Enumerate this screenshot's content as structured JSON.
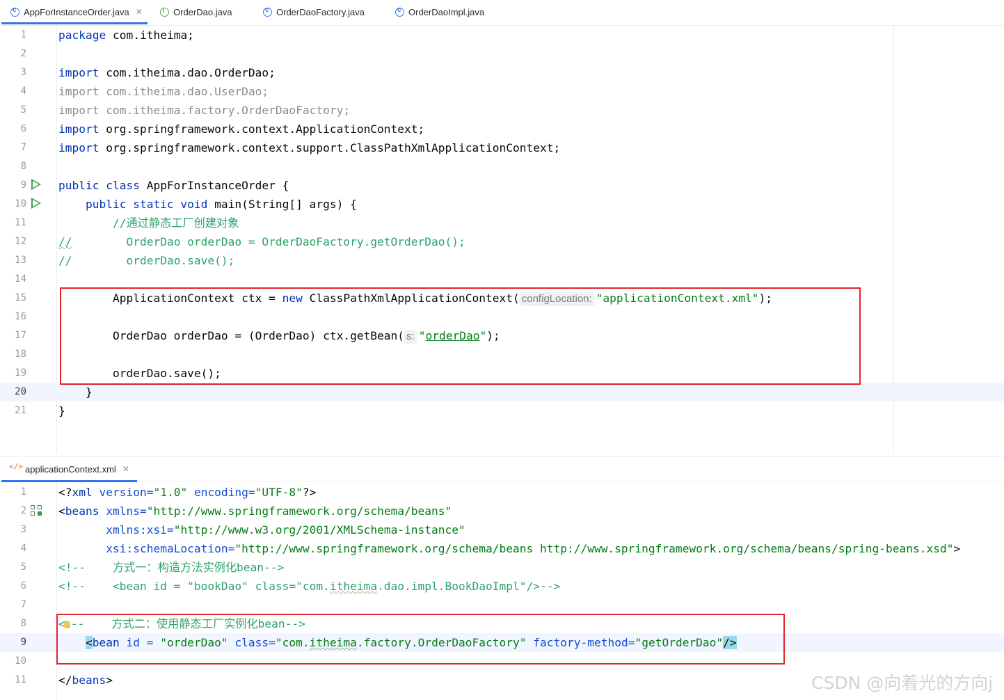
{
  "top_tabs": [
    {
      "label": "AppForInstanceOrder.java",
      "icon": "class-icon",
      "active": true,
      "closable": true
    },
    {
      "label": "OrderDao.java",
      "icon": "interface-icon"
    },
    {
      "label": "OrderDaoFactory.java",
      "icon": "class-icon"
    },
    {
      "label": "OrderDaoImpl.java",
      "icon": "class-icon"
    }
  ],
  "java_code": {
    "line_numbers": [
      "1",
      "2",
      "3",
      "4",
      "5",
      "6",
      "7",
      "8",
      "9",
      "10",
      "11",
      "12",
      "13",
      "14",
      "15",
      "16",
      "17",
      "18",
      "19",
      "20",
      "21"
    ],
    "l1": {
      "kw": "package",
      "rest": " com.itheima;"
    },
    "l3": {
      "kw": "import",
      "rest": " com.itheima.dao.OrderDao;"
    },
    "l4": {
      "kw": "import",
      "rest": " com.itheima.dao.UserDao;"
    },
    "l5": {
      "kw": "import",
      "rest": " com.itheima.factory.OrderDaoFactory;"
    },
    "l6": {
      "kw": "import",
      "rest": " org.springframework.context.ApplicationContext;"
    },
    "l7": {
      "kw": "import",
      "rest": " org.springframework.context.support.ClassPathXmlApplicationContext;"
    },
    "l9": {
      "kw": "public class",
      "rest": " AppForInstanceOrder {"
    },
    "l10": {
      "indent": "    ",
      "kw": "public static void",
      "rest": " main(String[] args) {"
    },
    "l11": {
      "indent": "        ",
      "comment": "//通过静态工厂创建对象"
    },
    "l12": {
      "prefix": "//",
      "indent": "        ",
      "comment": "OrderDao orderDao = OrderDaoFactory.getOrderDao();"
    },
    "l13": {
      "prefix": "//",
      "indent": "        ",
      "comment": "orderDao.save();"
    },
    "l15": {
      "indent": "        ",
      "a": "ApplicationContext ctx = ",
      "kw": "new",
      "b": " ClassPathXmlApplicationContext(",
      "hint": "configLocation:",
      "str": "\"applicationContext.xml\"",
      "end": ");"
    },
    "l17": {
      "indent": "        ",
      "a": "OrderDao orderDao = (OrderDao) ctx.getBean(",
      "hint": "s:",
      "q1": "\"",
      "str": "orderDao",
      "q2": "\"",
      "end": ");"
    },
    "l19": {
      "indent": "        ",
      "a": "orderDao.save();"
    },
    "l20": {
      "indent": "    ",
      "a": "}"
    },
    "l21": {
      "a": "}"
    }
  },
  "xml_tab": {
    "label": "applicationContext.xml",
    "icon": "xml-file-icon",
    "closable": true
  },
  "xml_code": {
    "line_numbers": [
      "1",
      "2",
      "3",
      "4",
      "5",
      "6",
      "7",
      "8",
      "9",
      "10",
      "11"
    ],
    "l1": {
      "p1": "<?",
      "tag": "xml",
      "a1": " version",
      "eq1": "=",
      "v1": "\"1.0\"",
      "a2": " encoding",
      "eq2": "=",
      "v2": "\"UTF-8\"",
      "p2": "?>"
    },
    "l2": {
      "p1": "<",
      "tag": "beans",
      "a1": " xmlns",
      "eq1": "=",
      "v1": "\"http://www.springframework.org/schema/beans\""
    },
    "l3": {
      "indent": "       ",
      "a1": "xmlns:xsi",
      "eq1": "=",
      "v1": "\"http://www.w3.org/2001/XMLSchema-instance\""
    },
    "l4": {
      "indent": "       ",
      "a1": "xsi:schemaLocation",
      "eq1": "=",
      "v1": "\"http://www.springframework.org/schema/beans http://www.springframework.org/schema/beans/spring-beans.xsd\"",
      "p2": ">"
    },
    "l5": {
      "comment": "<!--    方式一：构造方法实例化bean-->"
    },
    "l6": {
      "comment_a": "<!--    <bean id = \"bookDao\" class=\"com.",
      "comment_sq": "itheima",
      "comment_b": ".dao.impl.BookDaoImpl\"/>-->"
    },
    "l8": {
      "comment_a": "<",
      "comment_b": "--    方式二：使用静态工厂实例化bean-->"
    },
    "l9": {
      "indent": "    ",
      "p1": "<",
      "tag": "bean",
      "a1": " id = ",
      "v1": "\"orderDao\"",
      "a2": " class",
      "eq2": "=",
      "v2a": "\"com.",
      "v2sq": "itheima",
      "v2b": ".factory.OrderDaoFactory\"",
      "a3": " factory-method",
      "eq3": "=",
      "v3": "\"getOrderDao\"",
      "p2": "/>"
    },
    "l11": {
      "p1": "</",
      "tag": "beans",
      "p2": ">"
    }
  },
  "watermark": "CSDN @向着光的方向j",
  "colors": {
    "keyword": "#0033b3",
    "comment": "#2ca36b",
    "string": "#067d17",
    "highlight_box": "#e3242b",
    "tab_accent": "#3574f0"
  }
}
